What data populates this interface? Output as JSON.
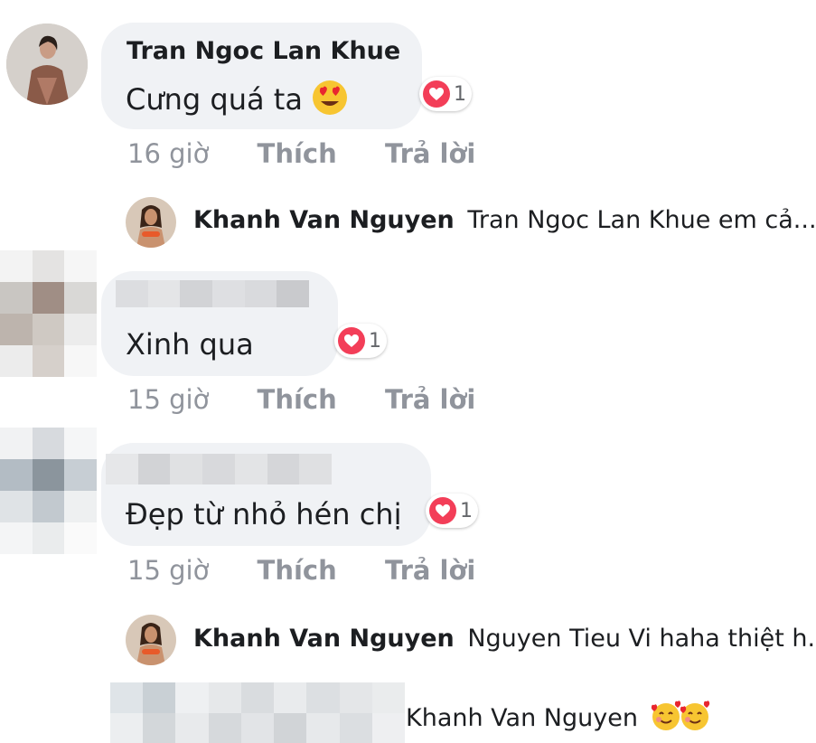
{
  "comments": [
    {
      "name": "Tran Ngoc Lan Khue",
      "text": "Cưng quá ta",
      "emoji": "heart-eyes-emoji",
      "reactions": "1",
      "time": "16 giờ",
      "like": "Thích",
      "reply": "Trả lời"
    },
    {
      "name": "",
      "text": "Xinh qua",
      "reactions": "1",
      "time": "15 giờ",
      "like": "Thích",
      "reply": "Trả lời"
    },
    {
      "name": "",
      "text": "Đẹp từ nhỏ hén chị",
      "reactions": "1",
      "time": "15 giờ",
      "like": "Thích",
      "reply": "Trả lời"
    }
  ],
  "replies": [
    {
      "name": "Khanh Van Nguyen",
      "text": "Tran Ngoc Lan Khue em cả..."
    },
    {
      "name": "Khanh Van Nguyen",
      "text": "Nguyen Tieu Vi haha thiệt h..."
    },
    {
      "name": "",
      "text": "Khanh Van Nguyen",
      "emoji": "smiling-hearts-emoji"
    }
  ],
  "colors": {
    "bubble": "#f0f2f5",
    "meta_text": "#90949c",
    "heart": "#f33e58"
  }
}
